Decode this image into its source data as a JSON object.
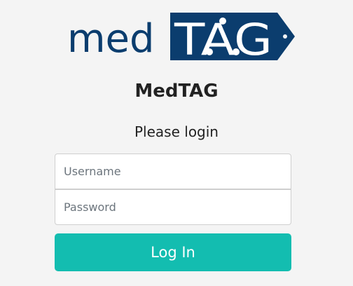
{
  "logo": {
    "wordmark_left": "med",
    "wordmark_tag": "TAG",
    "brand_color": "#0b3d6e",
    "tag_text_color": "#ffffff"
  },
  "app_title": "MedTAG",
  "subtitle": "Please login",
  "form": {
    "username": {
      "value": "",
      "placeholder": "Username"
    },
    "password": {
      "value": "",
      "placeholder": "Password"
    },
    "submit_label": "Log In"
  },
  "colors": {
    "background": "#f4f4f4",
    "accent": "#13bdb0"
  }
}
